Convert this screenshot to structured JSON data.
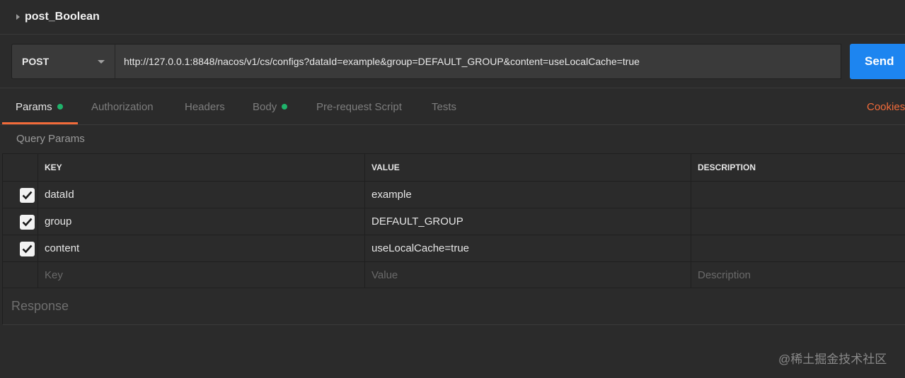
{
  "request": {
    "title": "post_Boolean",
    "method": "POST",
    "url": "http://127.0.0.1:8848/nacos/v1/cs/configs?dataId=example&group=DEFAULT_GROUP&content=useLocalCache=true",
    "send_label": "Send"
  },
  "tabs": [
    {
      "label": "Params",
      "active": true,
      "dot": true
    },
    {
      "label": "Authorization",
      "active": false,
      "dot": false
    },
    {
      "label": "Headers",
      "active": false,
      "dot": false
    },
    {
      "label": "Body",
      "active": false,
      "dot": true
    },
    {
      "label": "Pre-request Script",
      "active": false,
      "dot": false
    },
    {
      "label": "Tests",
      "active": false,
      "dot": false
    }
  ],
  "cookies_label": "Cookies",
  "query_params": {
    "label": "Query Params",
    "headers": {
      "key": "KEY",
      "value": "VALUE",
      "description": "DESCRIPTION"
    },
    "rows": [
      {
        "checked": true,
        "key": "dataId",
        "value": "example",
        "description": ""
      },
      {
        "checked": true,
        "key": "group",
        "value": "DEFAULT_GROUP",
        "description": ""
      },
      {
        "checked": true,
        "key": "content",
        "value": "useLocalCache=true",
        "description": ""
      }
    ],
    "placeholders": {
      "key": "Key",
      "value": "Value",
      "description": "Description"
    }
  },
  "response_label": "Response",
  "watermark": "@稀土掘金技术社区",
  "colors": {
    "send": "#1d85f0",
    "accent": "#f26b3a",
    "dot": "#1fb36b",
    "background": "#2b2b2b"
  }
}
